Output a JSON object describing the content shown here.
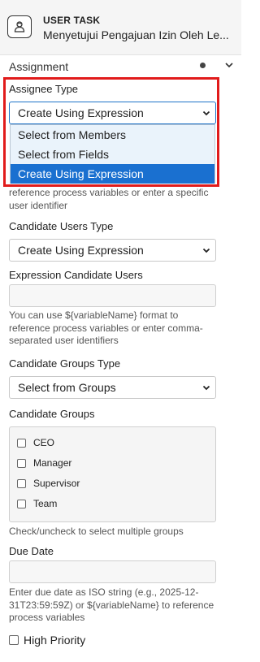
{
  "header": {
    "task_type": "USER TASK",
    "task_name": "Menyetujui Pengajuan Izin Oleh Le...",
    "icon": "user-task-icon"
  },
  "section": {
    "title": "Assignment"
  },
  "assignee_type": {
    "label": "Assignee Type",
    "value": "Create Using Expression",
    "options": [
      "Select from Members",
      "Select from Fields",
      "Create Using Expression"
    ]
  },
  "assignee_help": "reference process variables or enter a specific user identifier",
  "candidate_users_type": {
    "label": "Candidate Users Type",
    "value": "Create Using Expression"
  },
  "expression_candidate_users": {
    "label": "Expression Candidate Users",
    "value": "",
    "help": "You can use ${variableName} format to reference process variables or enter comma-separated user identifiers"
  },
  "candidate_groups_type": {
    "label": "Candidate Groups Type",
    "value": "Select from Groups"
  },
  "candidate_groups": {
    "label": "Candidate Groups",
    "items": [
      {
        "label": "CEO",
        "checked": false
      },
      {
        "label": "Manager",
        "checked": false
      },
      {
        "label": "Supervisor",
        "checked": false
      },
      {
        "label": "Team",
        "checked": false
      }
    ],
    "help": "Check/uncheck to select multiple groups"
  },
  "due_date": {
    "label": "Due Date",
    "value": "",
    "help": "Enter due date as ISO string (e.g., 2025-12-31T23:59:59Z) or ${variableName} to reference process variables"
  },
  "high_priority": {
    "label": "High Priority",
    "checked": false
  },
  "colors": {
    "highlight": "#e11b1b",
    "selected_option": "#1a70d0",
    "dropdown_bg": "#eaf3fb"
  }
}
